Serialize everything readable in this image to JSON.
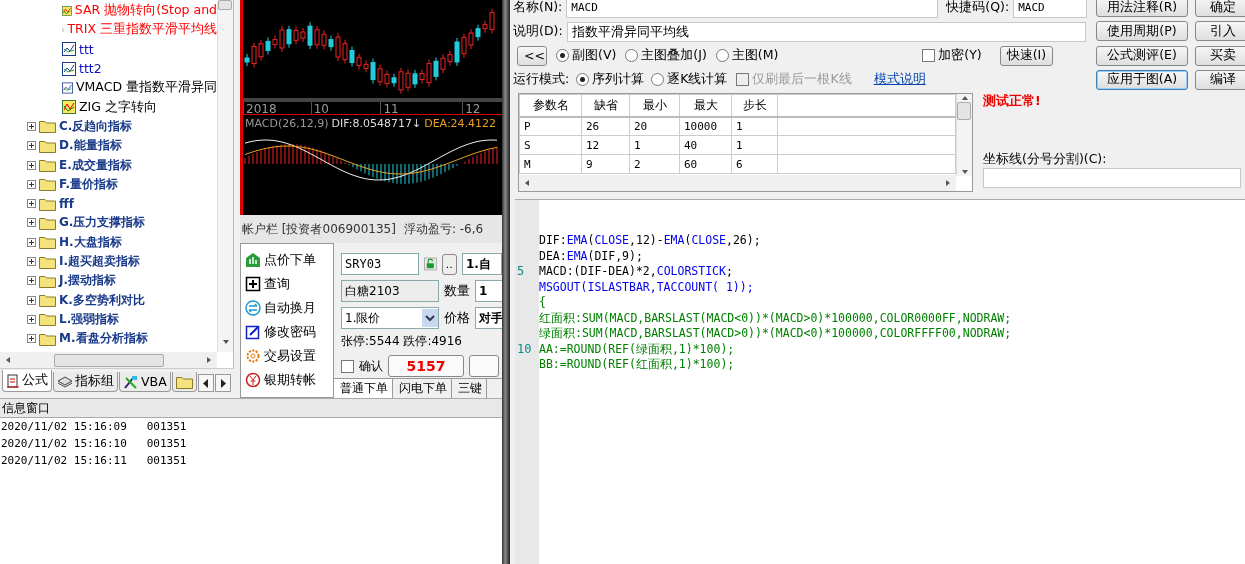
{
  "tree": {
    "visible_children": [
      {
        "label": "SAR 抛物转向(Stop and",
        "color": "#ff0000",
        "kind": "special"
      },
      {
        "label": "TRIX 三重指数平滑平均线",
        "color": "#ff0000",
        "kind": "line"
      },
      {
        "label": "ttt",
        "color": "#1010c0",
        "kind": "line"
      },
      {
        "label": "ttt2",
        "color": "#1010c0",
        "kind": "line"
      },
      {
        "label": "VMACD 量指数平滑异同",
        "color": "#000000",
        "kind": "line"
      },
      {
        "label": "ZIG 之字转向",
        "color": "#000000",
        "kind": "special"
      }
    ],
    "folders": [
      {
        "label": "C.反趋向指标",
        "expanded": false
      },
      {
        "label": "D.能量指标",
        "expanded": false
      },
      {
        "label": "E.成交量指标",
        "expanded": false
      },
      {
        "label": "F.量价指标",
        "expanded": false
      },
      {
        "label": "fff",
        "expanded": false
      },
      {
        "label": "G.压力支撑指标",
        "expanded": false
      },
      {
        "label": "H.大盘指标",
        "expanded": false
      },
      {
        "label": "I.超买超卖指标",
        "expanded": false
      },
      {
        "label": "J.摆动指标",
        "expanded": false
      },
      {
        "label": "K.多空势利对比",
        "expanded": false
      },
      {
        "label": "L.强弱指标",
        "expanded": false
      },
      {
        "label": "M.看盘分析指标",
        "expanded": false
      }
    ]
  },
  "tree_tabs": [
    {
      "label": "公式",
      "selected": true,
      "kind": "formula"
    },
    {
      "label": "指标组",
      "selected": false,
      "kind": "group"
    },
    {
      "label": "VBA",
      "selected": false,
      "kind": "vba"
    },
    {
      "selected": false,
      "kind": "folder"
    }
  ],
  "chart": {
    "axis_labels": [
      "2018",
      "10",
      "11",
      "12"
    ],
    "macd_legend": {
      "name": "MACD(26,12,9)",
      "dif": "DIF:8.0548717↓",
      "dea": "DEA:24.4122"
    }
  },
  "account_bar": {
    "title": "帐户栏 [投资者006900135]",
    "floating_pnl": "浮动盈亏: -6,6"
  },
  "order_menu": [
    {
      "label": "点价下单",
      "kind": "price"
    },
    {
      "label": "查询",
      "kind": "query"
    },
    {
      "label": "自动换月",
      "kind": "switch"
    },
    {
      "label": "修改密码",
      "kind": "password"
    },
    {
      "label": "交易设置",
      "kind": "settings"
    },
    {
      "label": "银期转帐",
      "kind": "transfer"
    }
  ],
  "order_form": {
    "contract_code": "SRY03",
    "browse_button": "..",
    "open_close": "1.自",
    "contract_name": "白糖2103",
    "quantity_label": "数量",
    "quantity": "1",
    "order_type": "1.限价",
    "price_label": "价格",
    "price": "对手",
    "limits": "张停:5544 跌停:4916",
    "confirm": {
      "label": "确认",
      "checked": false
    },
    "price_button": "5157",
    "tabs": [
      {
        "label": "普通下单",
        "selected": true
      },
      {
        "label": "闪电下单",
        "selected": false
      },
      {
        "label": "三键",
        "selected": false
      }
    ]
  },
  "info_window": {
    "title": "信息窗口",
    "lines": [
      "2020/11/02 15:16:09   001351",
      "2020/11/02 15:16:10   001351",
      "2020/11/02 15:16:11   001351"
    ]
  },
  "formula_editor": {
    "name": {
      "label": "名称(N):",
      "value": "MACD"
    },
    "shortcut": {
      "label": "快捷码(Q):",
      "value": "MACD"
    },
    "description": {
      "label": "说明(D):",
      "value": "指数平滑异同平均线"
    },
    "collapse_button": "<<",
    "chart_type": [
      {
        "label": "副图(V)",
        "selected": true
      },
      {
        "label": "主图叠加(J)",
        "selected": false
      },
      {
        "label": "主图(M)",
        "selected": false
      }
    ],
    "encrypt": {
      "label": "加密(Y)",
      "checked": false
    },
    "quick_button": "快速(I)",
    "run_mode": {
      "label": "运行模式:",
      "options": [
        {
          "label": "序列计算",
          "selected": true
        },
        {
          "label": "逐K线计算",
          "selected": false
        }
      ],
      "refresh_last": {
        "label": "仅刷最后一根K线",
        "checked": false,
        "disabled": true
      },
      "help_link": "模式说明"
    },
    "buttons": [
      {
        "label": "用法注释(R)",
        "focused": false
      },
      {
        "label": "确定",
        "focused": false
      },
      {
        "label": "使用周期(P)",
        "focused": false
      },
      {
        "label": "引入",
        "focused": false
      },
      {
        "label": "公式测评(E)",
        "focused": false
      },
      {
        "label": "买卖",
        "focused": false
      },
      {
        "label": "应用于图(A)",
        "focused": true
      },
      {
        "label": "编译",
        "focused": false
      }
    ],
    "params": {
      "columns": [
        "参数名",
        "缺省",
        "最小",
        "最大",
        "步长"
      ],
      "rows": [
        [
          "P",
          "26",
          "20",
          "10000",
          "1"
        ],
        [
          "S",
          "12",
          "1",
          "40",
          "1"
        ],
        [
          "M",
          "9",
          "2",
          "60",
          "6"
        ]
      ]
    },
    "test_status": "测试正常!",
    "axis_lines": {
      "label": "坐标线(分号分割)(C):"
    },
    "code": [
      {
        "parts": [
          {
            "text": "DIF:",
            "kind": "plain"
          },
          {
            "text": "EMA",
            "kind": "keyword"
          },
          {
            "text": "(",
            "kind": "plain"
          },
          {
            "text": "CLOSE",
            "kind": "keyword"
          },
          {
            "text": ",12)-",
            "kind": "plain"
          },
          {
            "text": "EMA",
            "kind": "keyword"
          },
          {
            "text": "(",
            "kind": "plain"
          },
          {
            "text": "CLOSE",
            "kind": "keyword"
          },
          {
            "text": ",26);",
            "kind": "plain"
          }
        ]
      },
      {
        "parts": [
          {
            "text": "DEA:",
            "kind": "plain"
          },
          {
            "text": "EMA",
            "kind": "keyword"
          },
          {
            "text": "(DIF,9);",
            "kind": "plain"
          }
        ]
      },
      {
        "number": "5",
        "parts": [
          {
            "text": "MACD:(DIF-DEA)*2,",
            "kind": "plain"
          },
          {
            "text": "COLORSTICK",
            "kind": "keyword"
          },
          {
            "text": ";",
            "kind": "plain"
          }
        ]
      },
      {
        "parts": [
          {
            "text": "MSGOUT(ISLASTBAR,TACCOUNT( 1));",
            "kind": "keyword"
          }
        ]
      },
      {
        "parts": [
          {
            "text": "{",
            "kind": "comment"
          }
        ]
      },
      {
        "parts": [
          {
            "text": "红面积:SUM(MACD,BARSLAST(MACD<0))*(MACD>0)*100000,COLOR0000FF,NODRAW;",
            "kind": "comment"
          }
        ]
      },
      {
        "parts": [
          {
            "text": "绿面积:SUM(MACD,BARSLAST(MACD>0))*(MACD<0)*100000,COLORFFFF00,NODRAW;",
            "kind": "comment"
          }
        ]
      },
      {
        "number": "10",
        "parts": [
          {
            "text": "AA:=ROUND(REF(绿面积,1)*100);",
            "kind": "comment"
          }
        ]
      },
      {
        "parts": [
          {
            "text": "BB:=ROUND(REF(红面积,1)*100);",
            "kind": "comment"
          }
        ]
      }
    ]
  }
}
